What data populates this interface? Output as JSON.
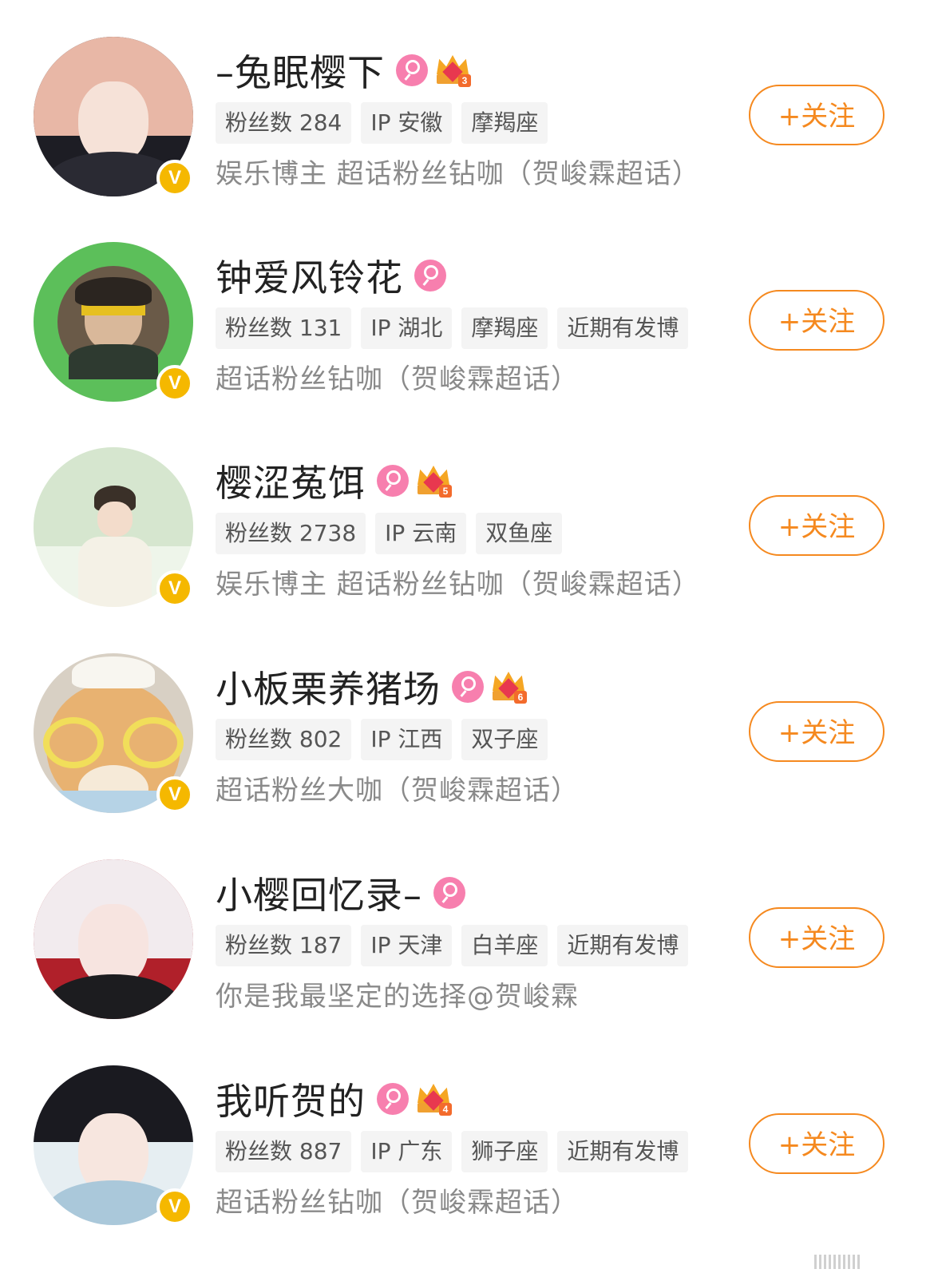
{
  "users": [
    {
      "name": "–兔眠樱下",
      "crown_level": "3",
      "has_crown": true,
      "tags": [
        "粉丝数 284",
        "IP 安徽",
        "摩羯座"
      ],
      "desc": "娱乐博主 超话粉丝钻咖（贺峻霖超话）",
      "follow_label": "+关注",
      "verified": "V"
    },
    {
      "name": "钟爱风铃花",
      "crown_level": "",
      "has_crown": false,
      "tags": [
        "粉丝数 131",
        "IP 湖北",
        "摩羯座",
        "近期有发博"
      ],
      "desc": "超话粉丝钻咖（贺峻霖超话）",
      "follow_label": "+关注",
      "verified": "V"
    },
    {
      "name": "樱涩菟饵",
      "crown_level": "5",
      "has_crown": true,
      "tags": [
        "粉丝数 2738",
        "IP 云南",
        "双鱼座"
      ],
      "desc": "娱乐博主 超话粉丝钻咖（贺峻霖超话）",
      "follow_label": "+关注",
      "verified": "V"
    },
    {
      "name": "小板栗养猪场",
      "crown_level": "6",
      "has_crown": true,
      "tags": [
        "粉丝数 802",
        "IP 江西",
        "双子座"
      ],
      "desc": "超话粉丝大咖（贺峻霖超话）",
      "follow_label": "+关注",
      "verified": "V"
    },
    {
      "name": "小樱回忆录–",
      "crown_level": "",
      "has_crown": false,
      "tags": [
        "粉丝数 187",
        "IP 天津",
        "白羊座",
        "近期有发博"
      ],
      "desc": "你是我最坚定的选择@贺峻霖",
      "follow_label": "+关注",
      "verified": ""
    },
    {
      "name": "我听贺的",
      "crown_level": "4",
      "has_crown": true,
      "tags": [
        "粉丝数 887",
        "IP 广东",
        "狮子座",
        "近期有发博"
      ],
      "desc": "超话粉丝钻咖（贺峻霖超话）",
      "follow_label": "+关注",
      "verified": "V"
    }
  ],
  "colors": {
    "accent_orange": "#f5891f",
    "female_pink": "#f77fae",
    "verified_gold": "#f5b800",
    "tag_bg": "#f4f4f4",
    "desc_gray": "#8a8a8a"
  }
}
